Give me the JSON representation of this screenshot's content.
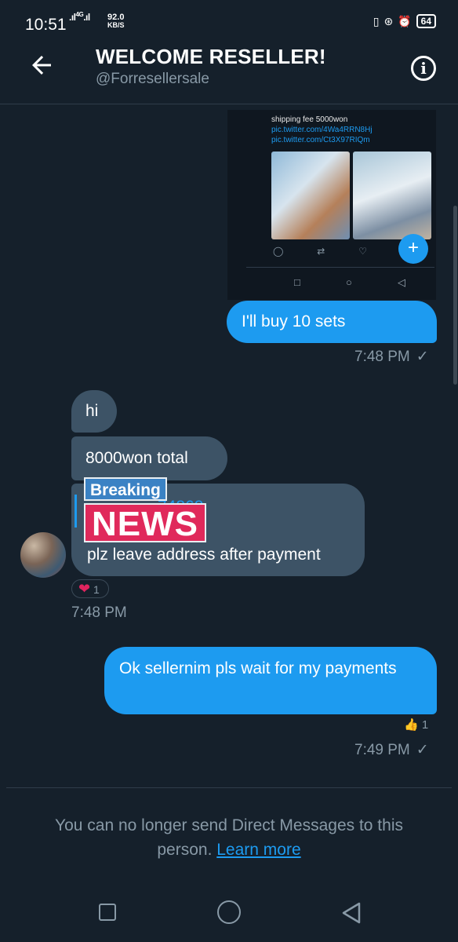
{
  "status_bar": {
    "time": "10:51",
    "signal": "4G",
    "net_speed": "92.0",
    "net_unit": "KB/S",
    "battery": "64"
  },
  "header": {
    "title": "WELCOME RESELLER!",
    "handle": "@Forresellersale"
  },
  "attachment": {
    "text": "shipping fee 5000won",
    "links": "pic.twitter.com/4Wa4RRN8Hj pic.twitter.com/Ct3X97RIQm"
  },
  "messages": [
    {
      "direction": "outgoing",
      "text": "I'll buy 10 sets",
      "time": "7:48 PM"
    },
    {
      "direction": "incoming",
      "text": "hi"
    },
    {
      "direction": "incoming",
      "text": "8000won total"
    },
    {
      "direction": "incoming",
      "quoted_link": "74868",
      "text": "plz leave address after payment",
      "reaction": "1",
      "time": "7:48 PM"
    },
    {
      "direction": "outgoing",
      "text": "Ok sellernim pls wait for my payments",
      "reaction": "1",
      "time": "7:49 PM"
    }
  ],
  "overlay": {
    "breaking": "Breaking",
    "news": "NEWS"
  },
  "notice": {
    "text": "You can no longer send Direct Messages to this person.",
    "link": "Learn more"
  },
  "colors": {
    "background": "#15202b",
    "outgoing_bubble": "#1d9bf0",
    "incoming_bubble": "#3d5366",
    "heart": "#e0245e"
  }
}
